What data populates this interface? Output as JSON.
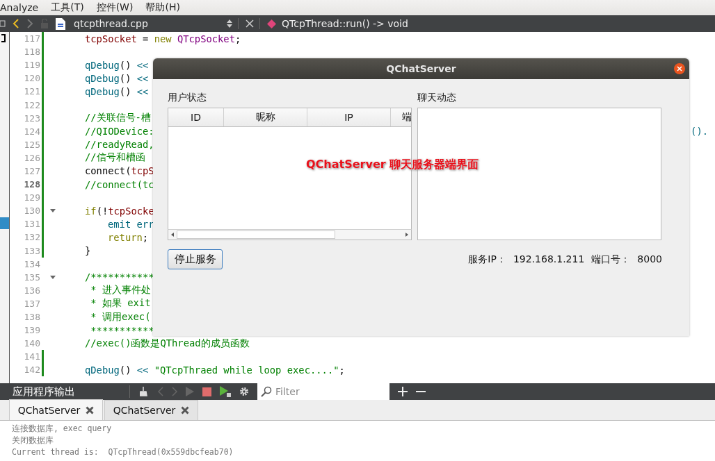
{
  "menu": [
    "Analyze",
    "工具(T)",
    "控件(W)",
    "帮助(H)"
  ],
  "editor_toolbar": {
    "file": "qtcpthread.cpp",
    "symbol": "QTcpThread::run() -> void"
  },
  "code_lines": [
    {
      "number": "117",
      "modified": true,
      "current": false,
      "foldable": false,
      "tokens": [
        {
          "text": "tcpSocket",
          "kind": "var"
        },
        {
          "text": " = ",
          "kind": "plain"
        },
        {
          "text": "new ",
          "kind": "kw"
        },
        {
          "text": "QTcpSocket",
          "kind": "type"
        },
        {
          "text": ";",
          "kind": "plain"
        }
      ]
    },
    {
      "number": "118",
      "modified": true,
      "current": false,
      "foldable": false
    },
    {
      "number": "119",
      "modified": true,
      "current": false,
      "foldable": false,
      "tokens": [
        {
          "text": "qDebug",
          "kind": "func"
        },
        {
          "text": "() ",
          "kind": "plain"
        },
        {
          "text": "<<",
          "kind": "op"
        }
      ]
    },
    {
      "number": "120",
      "modified": true,
      "current": false,
      "foldable": false,
      "tokens": [
        {
          "text": "qDebug",
          "kind": "func"
        },
        {
          "text": "() ",
          "kind": "plain"
        },
        {
          "text": "<<",
          "kind": "op"
        }
      ]
    },
    {
      "number": "121",
      "modified": true,
      "current": false,
      "foldable": false,
      "tokens": [
        {
          "text": "qDebug",
          "kind": "func"
        },
        {
          "text": "() ",
          "kind": "plain"
        },
        {
          "text": "<<",
          "kind": "op"
        }
      ]
    },
    {
      "number": "122",
      "modified": true,
      "current": false,
      "foldable": false
    },
    {
      "number": "123",
      "modified": true,
      "current": false,
      "foldable": false,
      "tokens": [
        {
          "text": "//关联信号-槽",
          "kind": "comment"
        }
      ]
    },
    {
      "number": "124",
      "modified": true,
      "current": false,
      "foldable": false,
      "tokens": [
        {
          "text": "//QIODevice:",
          "kind": "comment"
        }
      ],
      "tail": "()."
    },
    {
      "number": "125",
      "modified": true,
      "current": false,
      "foldable": false,
      "tokens": [
        {
          "text": "//readyRead,",
          "kind": "comment"
        }
      ]
    },
    {
      "number": "126",
      "modified": true,
      "current": false,
      "foldable": false,
      "tokens": [
        {
          "text": "//信号和槽函",
          "kind": "comment"
        }
      ]
    },
    {
      "number": "127",
      "modified": true,
      "current": false,
      "foldable": false,
      "tokens": [
        {
          "text": "connect(",
          "kind": "plain"
        },
        {
          "text": "tcpS",
          "kind": "var"
        }
      ]
    },
    {
      "number": "128",
      "modified": true,
      "current": true,
      "foldable": false,
      "tokens": [
        {
          "text": "//connect(tc",
          "kind": "comment"
        }
      ]
    },
    {
      "number": "129",
      "modified": true,
      "current": false,
      "foldable": false
    },
    {
      "number": "130",
      "modified": true,
      "current": false,
      "foldable": true,
      "tokens": [
        {
          "text": "if",
          "kind": "kw"
        },
        {
          "text": "(!",
          "kind": "plain"
        },
        {
          "text": "tcpSocke",
          "kind": "var"
        }
      ]
    },
    {
      "number": "131",
      "modified": true,
      "current": false,
      "foldable": false,
      "inner": true,
      "tokens": [
        {
          "text": "emit err",
          "kind": "func"
        }
      ]
    },
    {
      "number": "132",
      "modified": true,
      "current": false,
      "foldable": false,
      "inner": true,
      "tokens": [
        {
          "text": "return",
          "kind": "kw"
        },
        {
          "text": ";",
          "kind": "plain"
        }
      ]
    },
    {
      "number": "133",
      "modified": true,
      "current": false,
      "foldable": false,
      "tokens": [
        {
          "text": "}",
          "kind": "plain"
        }
      ]
    },
    {
      "number": "134",
      "modified": false,
      "current": false,
      "foldable": false
    },
    {
      "number": "135",
      "modified": false,
      "current": false,
      "foldable": true,
      "tokens": [
        {
          "text": "/***********",
          "kind": "comment"
        }
      ]
    },
    {
      "number": "136",
      "modified": false,
      "current": false,
      "foldable": false,
      "tokens": [
        {
          "text": " * 进入事件处",
          "kind": "comment"
        }
      ]
    },
    {
      "number": "137",
      "modified": false,
      "current": false,
      "foldable": false,
      "tokens": [
        {
          "text": " * 如果 exit",
          "kind": "comment"
        }
      ]
    },
    {
      "number": "138",
      "modified": false,
      "current": false,
      "foldable": false,
      "tokens": [
        {
          "text": " * 调用exec(",
          "kind": "comment"
        }
      ]
    },
    {
      "number": "139",
      "modified": false,
      "current": false,
      "foldable": false,
      "tokens": [
        {
          "text": " ***********",
          "kind": "comment"
        }
      ]
    },
    {
      "number": "140",
      "modified": false,
      "current": false,
      "foldable": false,
      "tokens": [
        {
          "text": "//exec()函数是QThread的成员函数",
          "kind": "comment"
        }
      ]
    },
    {
      "number": "141",
      "modified": true,
      "current": false,
      "foldable": false
    },
    {
      "number": "142",
      "modified": true,
      "current": false,
      "foldable": false,
      "tokens": [
        {
          "text": "qDebug",
          "kind": "func"
        },
        {
          "text": "() ",
          "kind": "plain"
        },
        {
          "text": "<< ",
          "kind": "op"
        },
        {
          "text": "\"QTcpThraed while loop exec....\"",
          "kind": "str"
        },
        {
          "text": ";",
          "kind": "plain"
        }
      ]
    }
  ],
  "dialog": {
    "title": "QChatServer",
    "user_status_label": "用户状态",
    "chat_label": "聊天动态",
    "columns": [
      "ID",
      "昵称",
      "IP",
      "端"
    ],
    "stop_button": "停止服务",
    "server_ip_label": "服务IP：",
    "server_ip": "192.168.1.211",
    "port_label": "端口号：",
    "port": "8000"
  },
  "annotation": "QChatServer 聊天服务器端界面",
  "output_panel": {
    "title": "应用程序输出",
    "filter": {
      "placeholder": "Filter"
    },
    "tabs": [
      {
        "label": "QChatServer",
        "selected": true
      },
      {
        "label": "QChatServer",
        "selected": false
      }
    ],
    "lines": [
      "连接数据库, exec query",
      "关闭数据库",
      "Current thread is:  QTcpThread(0x559dbcfeab70)"
    ]
  }
}
